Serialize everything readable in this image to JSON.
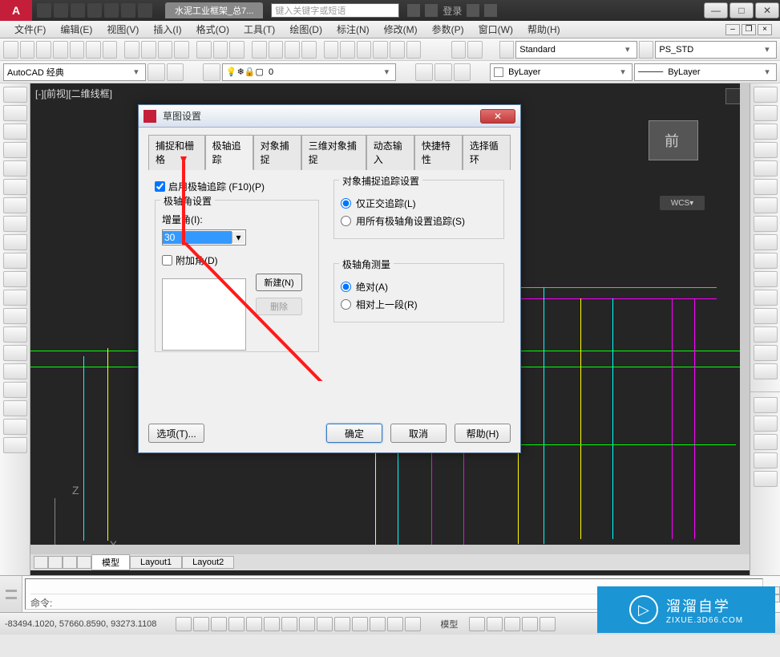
{
  "title": {
    "doc_tab": "水泥工业框架_总7...",
    "search_placeholder": "键入关键字或短语",
    "login": "登录"
  },
  "menubar": {
    "items": [
      "文件(F)",
      "编辑(E)",
      "视图(V)",
      "插入(I)",
      "格式(O)",
      "工具(T)",
      "绘图(D)",
      "标注(N)",
      "修改(M)",
      "参数(P)",
      "窗口(W)",
      "帮助(H)"
    ]
  },
  "toolbars": {
    "workspace": "AutoCAD 经典",
    "layer_combo": "0",
    "text_style_btn": "Standard",
    "dim_style_btn": "PS_STD",
    "color_combo": "ByLayer",
    "ltype_combo": "ByLayer"
  },
  "drawing": {
    "view_label": "[-][前视][二维线框]",
    "view_cube": "前",
    "wcs": "WCS",
    "layout_tabs": [
      "模型",
      "Layout1",
      "Layout2"
    ]
  },
  "command": {
    "prompt": "命令:"
  },
  "statusbar": {
    "coords": "-83494.1020, 57660.8590, 93273.1108",
    "mode_label": "模型"
  },
  "dialog": {
    "title": "草图设置",
    "tabs": [
      "捕捉和栅格",
      "极轴追踪",
      "对象捕捉",
      "三维对象捕捉",
      "动态输入",
      "快捷特性",
      "选择循环"
    ],
    "active_tab": 1,
    "enable_polar": "启用极轴追踪 (F10)(P)",
    "polar_group": "极轴角设置",
    "increment_label": "增量角(I):",
    "increment_value": "30",
    "additional_label": "附加角(D)",
    "new_btn": "新建(N)",
    "delete_btn": "删除",
    "osnap_group": "对象捕捉追踪设置",
    "osnap_opt1": "仅正交追踪(L)",
    "osnap_opt2": "用所有极轴角设置追踪(S)",
    "measure_group": "极轴角测量",
    "measure_opt1": "绝对(A)",
    "measure_opt2": "相对上一段(R)",
    "options_btn": "选项(T)...",
    "ok_btn": "确定",
    "cancel_btn": "取消",
    "help_btn": "帮助(H)"
  },
  "watermark": {
    "big": "溜溜自学",
    "small": "ZIXUE.3D66.COM"
  }
}
